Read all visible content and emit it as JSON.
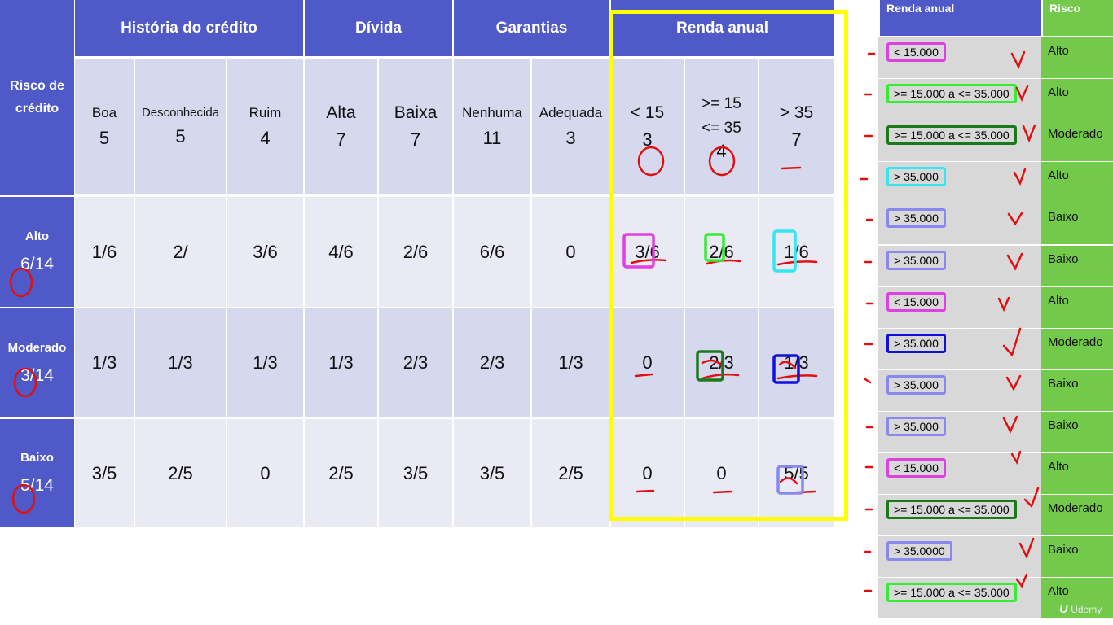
{
  "table": {
    "corner": "Risco de crédito",
    "groups": [
      "História do crédito",
      "Dívida",
      "Garantias",
      "Renda anual"
    ],
    "columns": [
      {
        "name": "Boa",
        "count": "5"
      },
      {
        "name": "Desconhecida",
        "count": "5"
      },
      {
        "name": "Ruim",
        "count": "4"
      },
      {
        "name": "Alta",
        "count": "7"
      },
      {
        "name": "Baixa",
        "count": "7"
      },
      {
        "name": "Nenhuma",
        "count": "11"
      },
      {
        "name": "Adequada",
        "count": "3"
      },
      {
        "name": "< 15",
        "count": "3"
      },
      {
        "name": ">= 15\n<= 35",
        "count": "4"
      },
      {
        "name": "> 35",
        "count": "7"
      }
    ],
    "rows": [
      {
        "label": "Alto",
        "score": "6/14",
        "cells": [
          "1/6",
          "2/",
          "3/6",
          "4/6",
          "2/6",
          "6/6",
          "0",
          "3/6",
          "2/6",
          "1/6"
        ]
      },
      {
        "label": "Moderado",
        "score": "3/14",
        "cells": [
          "1/3",
          "1/3",
          "1/3",
          "1/3",
          "2/3",
          "2/3",
          "1/3",
          "0",
          "2/3",
          "1/3"
        ]
      },
      {
        "label": "Baixo",
        "score": "5/14",
        "cells": [
          "3/5",
          "2/5",
          "0",
          "2/5",
          "3/5",
          "3/5",
          "2/5",
          "0",
          "0",
          "5/5"
        ]
      }
    ]
  },
  "panel": {
    "header_renda": "Renda anual",
    "header_risco": "Risco",
    "header_renda_color": "#4f59c8",
    "header_risco_color": "#72c94a",
    "rows": [
      {
        "renda": "< 15.000",
        "risco": "Alto",
        "box_color": "#e040e0"
      },
      {
        "renda": ">= 15.000 a <= 35.000",
        "risco": "Alto",
        "box_color": "#33ee33"
      },
      {
        "renda": ">= 15.000 a <= 35.000",
        "risco": "Moderado",
        "box_color": "#1a7a1a"
      },
      {
        "renda": "> 35.000",
        "risco": "Alto",
        "box_color": "#33e6f0"
      },
      {
        "renda": "> 35.000",
        "risco": "Baixo",
        "box_color": "#8888ee"
      },
      {
        "renda": "> 35.000",
        "risco": "Baixo",
        "box_color": "#8888ee"
      },
      {
        "renda": "< 15.000",
        "risco": "Alto",
        "box_color": "#e040e0"
      },
      {
        "renda": "> 35.000",
        "risco": "Moderado",
        "box_color": "#1010dd"
      },
      {
        "renda": "> 35.000",
        "risco": "Baixo",
        "box_color": "#8888ee"
      },
      {
        "renda": "> 35.000",
        "risco": "Baixo",
        "box_color": "#8888ee"
      },
      {
        "renda": "< 15.000",
        "risco": "Alto",
        "box_color": "#e040e0"
      },
      {
        "renda": ">= 15.000 a <= 35.000",
        "risco": "Moderado",
        "box_color": "#1a7a1a"
      },
      {
        "renda": "> 35.0000",
        "risco": "Baixo",
        "box_color": "#8888ee"
      },
      {
        "renda": ">= 15.000 a <= 35.000",
        "risco": "Alto",
        "box_color": "#33ee33"
      }
    ]
  },
  "watermark": "Udemy",
  "colors": {
    "header": "#4f59c8",
    "highlight": "#ffff00",
    "ink": "#e01010"
  }
}
